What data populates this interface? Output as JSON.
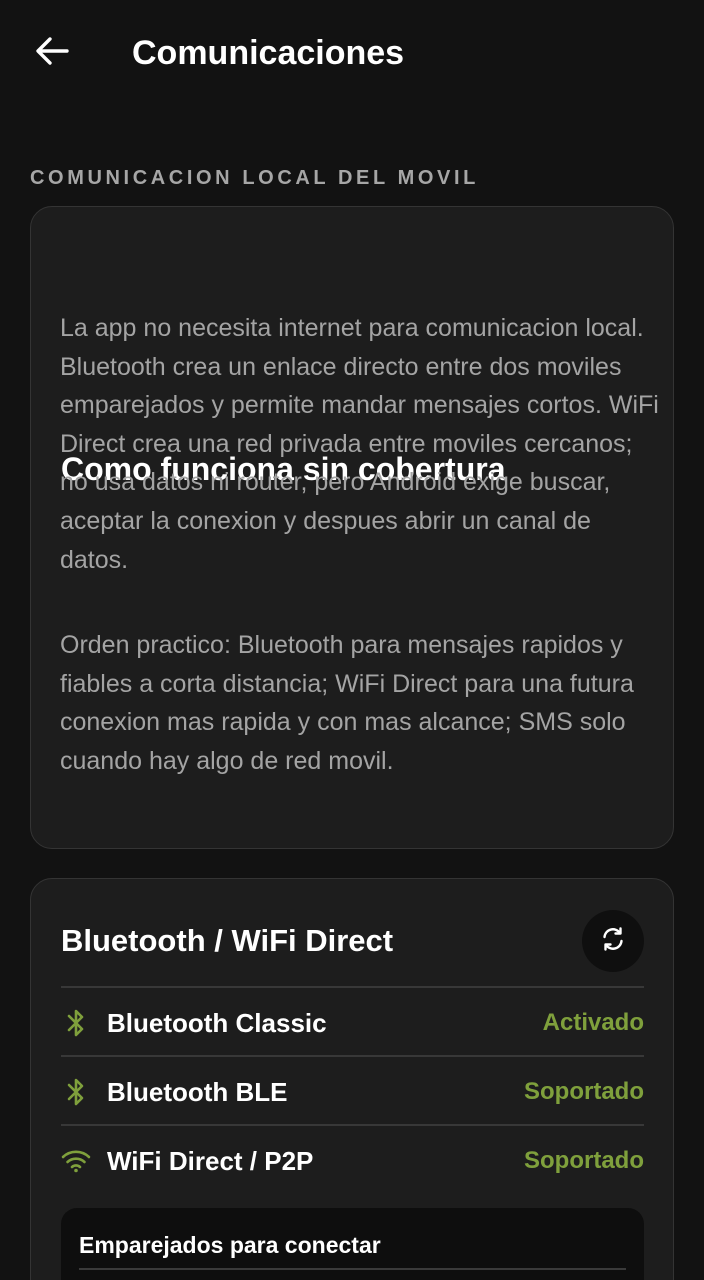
{
  "header": {
    "title": "Comunicaciones",
    "back_icon": "arrow-left-icon"
  },
  "section": {
    "label": "COMUNICACION LOCAL DEL MOVIL"
  },
  "info_card": {
    "title": "Como funciona sin cobertura",
    "paragraph_1": "La app no necesita internet para comunicacion local. Bluetooth crea un enlace directo entre dos moviles emparejados y permite mandar mensajes cortos. WiFi Direct crea una red privada entre moviles cercanos; no usa datos ni router, pero Android exige buscar, aceptar la conexion y despues abrir un canal de datos.",
    "paragraph_2": "Orden practico: Bluetooth para mensajes rapidos y fiables a corta distancia; WiFi Direct para una futura conexion mas rapida y con mas alcance; SMS solo cuando hay algo de red movil."
  },
  "connectivity_card": {
    "title": "Bluetooth / WiFi Direct",
    "refresh_icon": "refresh-icon",
    "rows": [
      {
        "label": "Bluetooth Classic",
        "status": "Activado",
        "icon": "bluetooth-icon"
      },
      {
        "label": "Bluetooth BLE",
        "status": "Soportado",
        "icon": "bluetooth-icon"
      },
      {
        "label": "WiFi Direct / P2P",
        "status": "Soportado",
        "icon": "wifi-icon"
      }
    ],
    "paired_title": "Emparejados para conectar"
  },
  "colors": {
    "background": "#121212",
    "card": "#1d1d1d",
    "status_green": "#7fa03c",
    "muted_text": "#a4a4a4"
  }
}
